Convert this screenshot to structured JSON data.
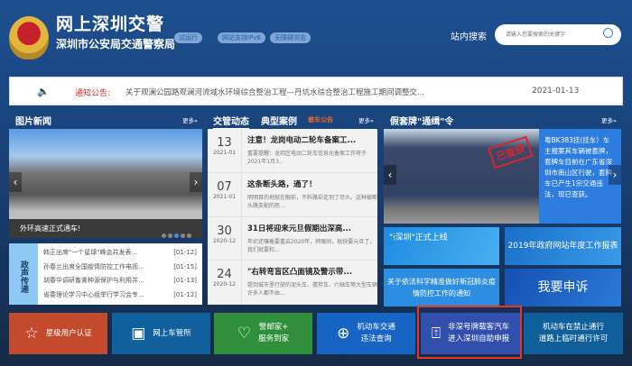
{
  "header": {
    "title": "网上深圳交警",
    "subtitle": "深圳市公安局交通警察局",
    "badges": [
      "试运行",
      "网站支持IPv6",
      "无障碍浏览"
    ],
    "search_label": "站内搜索",
    "search_placeholder": "请输入您要搜索的关键字"
  },
  "notice": {
    "label": "通知公告:",
    "text": "关于观澜公园路观澜河流域水环境综合整治工程—丹坑水综合整治工程施工期间调整交...",
    "date": "2021-01-13"
  },
  "sections": {
    "photo_news": "图片新闻",
    "more": "更多»",
    "tabs": [
      "交管动态",
      "典型案例",
      "撤车公告"
    ],
    "fake_plate": "假套牌\"通缉\"令"
  },
  "slider": {
    "caption": "外环高速正式通车!",
    "prev": "‹",
    "next": "›"
  },
  "gov": {
    "label": "政声传递",
    "items": [
      {
        "t": "韩正出席\"一个星球\"峰会并发表...",
        "d": "[01-12]"
      },
      {
        "t": "孙春兰出席全国疫情防控工作电视...",
        "d": "[01-15]"
      },
      {
        "t": "胡春华调研畜禽种源保护与利用并...",
        "d": "[01-13]"
      },
      {
        "t": "省委理论学习中心组举行学习会专...",
        "d": "[01-12]"
      }
    ]
  },
  "news": [
    {
      "day": "13",
      "ym": "2021-01",
      "title": "注意！龙岗电动二轮车备案工...",
      "summary": "重要提醒：龙岗区电动二轮车信息化备案工作将于2021年1月3..."
    },
    {
      "day": "07",
      "ym": "2021-01",
      "title": "这条断头路，通了！",
      "summary": "明明目的地就在眼前，不料路却走到了尽头。这种被断头路支配的恐..."
    },
    {
      "day": "30",
      "ym": "2020-12",
      "title": "31日将迎来元旦假期出深高...",
      "summary": "年初还嚷着要重启2020年，转眼间，就快要元旦了，我们就要和..."
    },
    {
      "day": "24",
      "ym": "2020-12",
      "title": "\"右转弯盲区凸面镜及警示带...",
      "summary": "提到城市里行驶的泥头车、搅拌车、六轴车等大型车辆许多人都不由..."
    }
  ],
  "case": {
    "stamp": "已查获",
    "text": "粤BK383挂(挂车）车主报案其车辆被套牌，套牌车目前在广东省深圳市南山区行驶，套牌车已产生1宗交通违法，现已查获。"
  },
  "tiles": [
    "\"i深圳\"正式上线",
    "2019年政府网站年度工作报表",
    "关于依法科学精准做好新冠肺炎疫情防控工作的通知",
    "我要申诉"
  ],
  "buttons": [
    {
      "l1": "星级用户认证",
      "l2": ""
    },
    {
      "l1": "网上车管所",
      "l2": ""
    },
    {
      "l1": "警邮家+",
      "l2": "服务到家"
    },
    {
      "l1": "机动车交通",
      "l2": "违法查询"
    },
    {
      "l1": "非深号牌载客汽车",
      "l2": "进入深圳自助申报"
    },
    {
      "l1": "机动车在禁止通行",
      "l2": "道路上临时通行许可"
    }
  ]
}
